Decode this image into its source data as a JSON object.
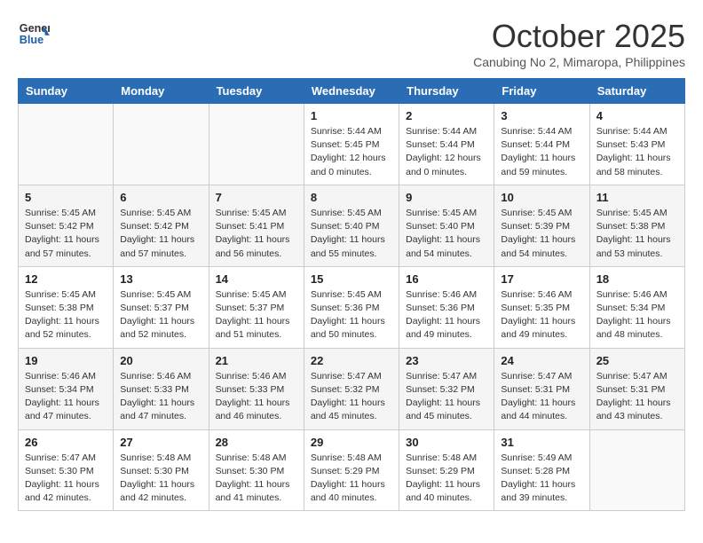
{
  "header": {
    "logo_line1": "General",
    "logo_line2": "Blue",
    "month": "October 2025",
    "location": "Canubing No 2, Mimaropa, Philippines"
  },
  "weekdays": [
    "Sunday",
    "Monday",
    "Tuesday",
    "Wednesday",
    "Thursday",
    "Friday",
    "Saturday"
  ],
  "weeks": [
    [
      {
        "day": "",
        "info": ""
      },
      {
        "day": "",
        "info": ""
      },
      {
        "day": "",
        "info": ""
      },
      {
        "day": "1",
        "info": "Sunrise: 5:44 AM\nSunset: 5:45 PM\nDaylight: 12 hours\nand 0 minutes."
      },
      {
        "day": "2",
        "info": "Sunrise: 5:44 AM\nSunset: 5:44 PM\nDaylight: 12 hours\nand 0 minutes."
      },
      {
        "day": "3",
        "info": "Sunrise: 5:44 AM\nSunset: 5:44 PM\nDaylight: 11 hours\nand 59 minutes."
      },
      {
        "day": "4",
        "info": "Sunrise: 5:44 AM\nSunset: 5:43 PM\nDaylight: 11 hours\nand 58 minutes."
      }
    ],
    [
      {
        "day": "5",
        "info": "Sunrise: 5:45 AM\nSunset: 5:42 PM\nDaylight: 11 hours\nand 57 minutes."
      },
      {
        "day": "6",
        "info": "Sunrise: 5:45 AM\nSunset: 5:42 PM\nDaylight: 11 hours\nand 57 minutes."
      },
      {
        "day": "7",
        "info": "Sunrise: 5:45 AM\nSunset: 5:41 PM\nDaylight: 11 hours\nand 56 minutes."
      },
      {
        "day": "8",
        "info": "Sunrise: 5:45 AM\nSunset: 5:40 PM\nDaylight: 11 hours\nand 55 minutes."
      },
      {
        "day": "9",
        "info": "Sunrise: 5:45 AM\nSunset: 5:40 PM\nDaylight: 11 hours\nand 54 minutes."
      },
      {
        "day": "10",
        "info": "Sunrise: 5:45 AM\nSunset: 5:39 PM\nDaylight: 11 hours\nand 54 minutes."
      },
      {
        "day": "11",
        "info": "Sunrise: 5:45 AM\nSunset: 5:38 PM\nDaylight: 11 hours\nand 53 minutes."
      }
    ],
    [
      {
        "day": "12",
        "info": "Sunrise: 5:45 AM\nSunset: 5:38 PM\nDaylight: 11 hours\nand 52 minutes."
      },
      {
        "day": "13",
        "info": "Sunrise: 5:45 AM\nSunset: 5:37 PM\nDaylight: 11 hours\nand 52 minutes."
      },
      {
        "day": "14",
        "info": "Sunrise: 5:45 AM\nSunset: 5:37 PM\nDaylight: 11 hours\nand 51 minutes."
      },
      {
        "day": "15",
        "info": "Sunrise: 5:45 AM\nSunset: 5:36 PM\nDaylight: 11 hours\nand 50 minutes."
      },
      {
        "day": "16",
        "info": "Sunrise: 5:46 AM\nSunset: 5:36 PM\nDaylight: 11 hours\nand 49 minutes."
      },
      {
        "day": "17",
        "info": "Sunrise: 5:46 AM\nSunset: 5:35 PM\nDaylight: 11 hours\nand 49 minutes."
      },
      {
        "day": "18",
        "info": "Sunrise: 5:46 AM\nSunset: 5:34 PM\nDaylight: 11 hours\nand 48 minutes."
      }
    ],
    [
      {
        "day": "19",
        "info": "Sunrise: 5:46 AM\nSunset: 5:34 PM\nDaylight: 11 hours\nand 47 minutes."
      },
      {
        "day": "20",
        "info": "Sunrise: 5:46 AM\nSunset: 5:33 PM\nDaylight: 11 hours\nand 47 minutes."
      },
      {
        "day": "21",
        "info": "Sunrise: 5:46 AM\nSunset: 5:33 PM\nDaylight: 11 hours\nand 46 minutes."
      },
      {
        "day": "22",
        "info": "Sunrise: 5:47 AM\nSunset: 5:32 PM\nDaylight: 11 hours\nand 45 minutes."
      },
      {
        "day": "23",
        "info": "Sunrise: 5:47 AM\nSunset: 5:32 PM\nDaylight: 11 hours\nand 45 minutes."
      },
      {
        "day": "24",
        "info": "Sunrise: 5:47 AM\nSunset: 5:31 PM\nDaylight: 11 hours\nand 44 minutes."
      },
      {
        "day": "25",
        "info": "Sunrise: 5:47 AM\nSunset: 5:31 PM\nDaylight: 11 hours\nand 43 minutes."
      }
    ],
    [
      {
        "day": "26",
        "info": "Sunrise: 5:47 AM\nSunset: 5:30 PM\nDaylight: 11 hours\nand 42 minutes."
      },
      {
        "day": "27",
        "info": "Sunrise: 5:48 AM\nSunset: 5:30 PM\nDaylight: 11 hours\nand 42 minutes."
      },
      {
        "day": "28",
        "info": "Sunrise: 5:48 AM\nSunset: 5:30 PM\nDaylight: 11 hours\nand 41 minutes."
      },
      {
        "day": "29",
        "info": "Sunrise: 5:48 AM\nSunset: 5:29 PM\nDaylight: 11 hours\nand 40 minutes."
      },
      {
        "day": "30",
        "info": "Sunrise: 5:48 AM\nSunset: 5:29 PM\nDaylight: 11 hours\nand 40 minutes."
      },
      {
        "day": "31",
        "info": "Sunrise: 5:49 AM\nSunset: 5:28 PM\nDaylight: 11 hours\nand 39 minutes."
      },
      {
        "day": "",
        "info": ""
      }
    ]
  ]
}
